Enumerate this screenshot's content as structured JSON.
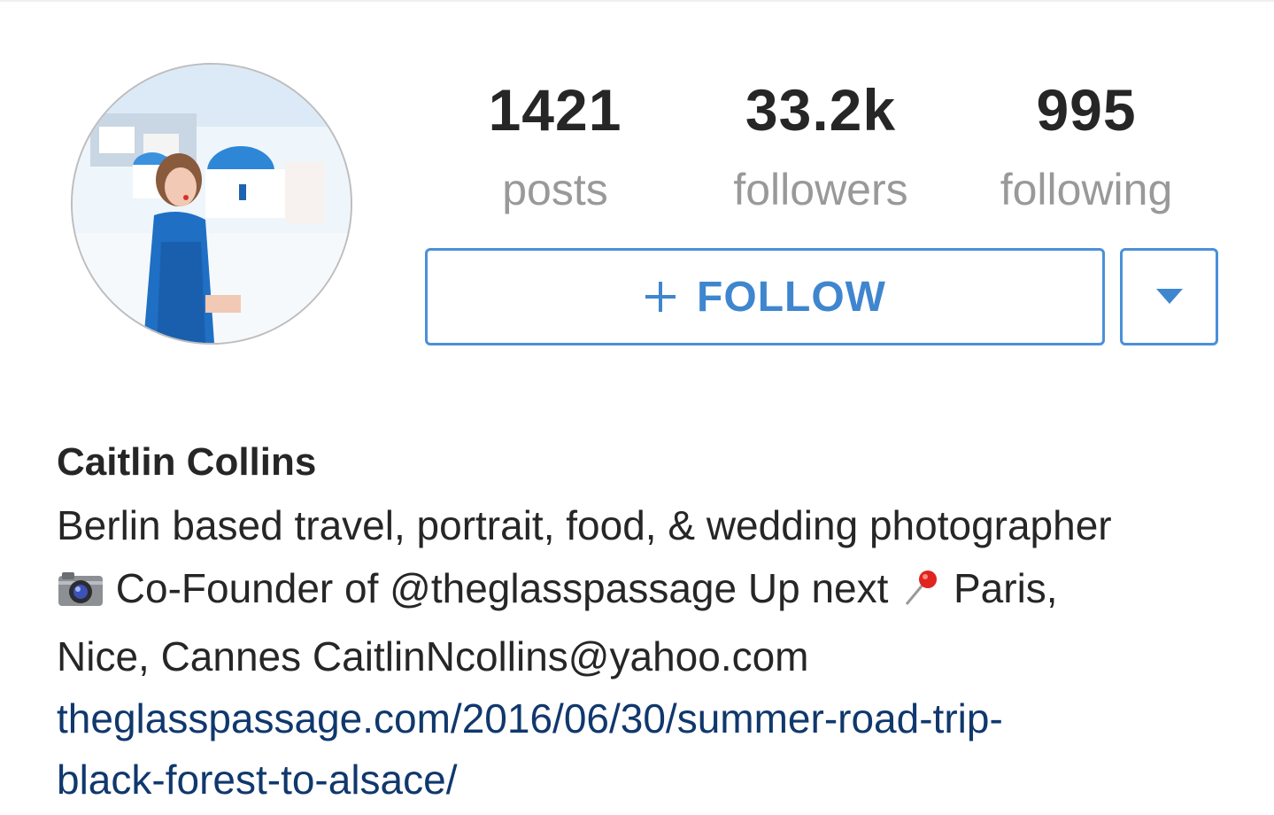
{
  "profile": {
    "avatar_alt": "profile photo",
    "stats": {
      "posts": {
        "value": "1421",
        "label": "posts"
      },
      "followers": {
        "value": "33.2k",
        "label": "followers"
      },
      "following": {
        "value": "995",
        "label": "following"
      }
    },
    "follow_button": {
      "icon": "plus-icon",
      "label": "FOLLOW"
    },
    "dropdown_button": {
      "icon": "caret-down-icon"
    },
    "name": "Caitlin Collins",
    "bio": {
      "line1": "Berlin based travel, portrait, food, & wedding photographer",
      "line2_icon": "camera-emoji-icon",
      "line2_text": "Co-Founder of @theglasspassage Up next",
      "line2_pin_icon": "pushpin-emoji-icon",
      "line2_after": "Paris,",
      "line3": "Nice, Cannes CaitlinNcollins@yahoo.com"
    },
    "website": {
      "line1": "theglasspassage.com/2016/06/30/summer-road-trip-",
      "line2": "black-forest-to-alsace/"
    }
  },
  "colors": {
    "accent": "#3f86cf",
    "link": "#10386d",
    "muted": "#999999",
    "text": "#262626"
  }
}
